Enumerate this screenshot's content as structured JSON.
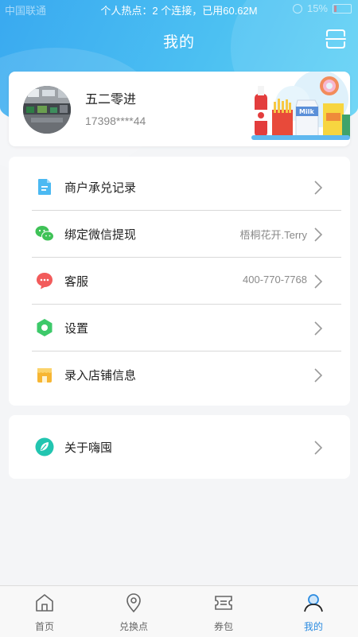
{
  "status_bar": {
    "carrier": "中国联通",
    "hotspot_text": "个人热点：2 个连接，已用60.62M",
    "battery": "15%"
  },
  "header": {
    "title": "我的",
    "scan_icon": "scan-icon"
  },
  "profile": {
    "name": "五二零进",
    "phone": "17398****44"
  },
  "menu": [
    {
      "label": "商户承兑记录",
      "value": "",
      "icon": "document-icon",
      "color": "#4bb9f2"
    },
    {
      "label": "绑定微信提现",
      "value": "梧桐花开.Terry",
      "icon": "wechat-icon",
      "color": "#3fc257"
    },
    {
      "label": "客服",
      "value": "400-770-7768",
      "icon": "chat-bubble-icon",
      "color": "#f25b5b"
    },
    {
      "label": "设置",
      "value": "",
      "icon": "gear-icon",
      "color": "#3dc96a"
    },
    {
      "label": "录入店铺信息",
      "value": "",
      "icon": "store-icon",
      "color": "#f7b633"
    }
  ],
  "about": {
    "label": "关于嗨囤",
    "icon": "leaf-icon",
    "color": "#22c5b0"
  },
  "tabs": [
    {
      "label": "首页",
      "icon": "home-icon",
      "active": false
    },
    {
      "label": "兑换点",
      "icon": "location-pin-icon",
      "active": false
    },
    {
      "label": "券包",
      "icon": "coupon-icon",
      "active": false
    },
    {
      "label": "我的",
      "icon": "user-icon",
      "active": true
    }
  ],
  "colors": {
    "accent": "#2b8be0",
    "header_gradient_start": "#39a9f0",
    "header_gradient_end": "#62d3f5"
  }
}
